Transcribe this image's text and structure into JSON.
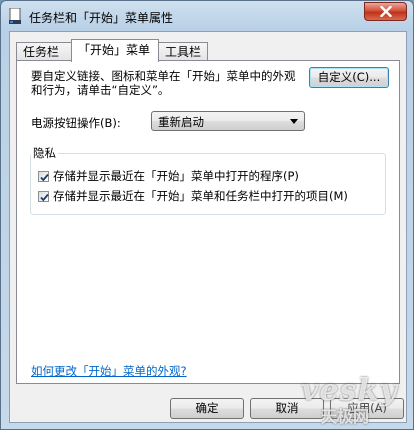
{
  "window": {
    "title": "任务栏和「开始」菜单属性",
    "app_icon": "taskbar-properties-icon",
    "close_icon": "close-icon",
    "close_color": "#c7402a"
  },
  "tabs": [
    {
      "label": "任务栏",
      "active": false
    },
    {
      "label": "「开始」菜单",
      "active": true
    },
    {
      "label": "工具栏",
      "active": false
    }
  ],
  "start_menu": {
    "description": "要自定义链接、图标和菜单在「开始」菜单中的外观和行为，请单击“自定义”。",
    "customize_label": "自定义(C)...",
    "power_button": {
      "label": "电源按钮操作(B):",
      "value": "重新启动"
    },
    "privacy": {
      "title": "隐私",
      "items": [
        {
          "label": "存储并显示最近在「开始」菜单中打开的程序(P)",
          "checked": true
        },
        {
          "label": "存储并显示最近在「开始」菜单和任务栏中打开的项目(M)",
          "checked": true
        }
      ]
    },
    "help_link": "如何更改「开始」菜单的外观?"
  },
  "buttons": {
    "ok": "确定",
    "cancel": "取消",
    "apply": "应用(A)"
  },
  "watermark": {
    "brand": "vesky",
    "caption": "天极网"
  }
}
